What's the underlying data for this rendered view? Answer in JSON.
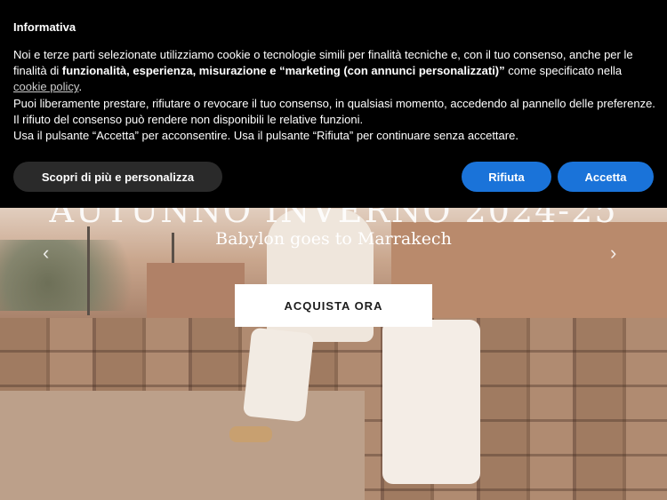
{
  "hero": {
    "title": "AUTUNNO INVERNO 2024-25",
    "subtitle": "Babylon goes to Marrakech",
    "cta_label": "ACQUISTA ORA",
    "prev_arrow": "‹",
    "next_arrow": "›"
  },
  "cookie_banner": {
    "title": "Informativa",
    "para1_start": "Noi e terze parti selezionate utilizziamo cookie o tecnologie simili per finalità tecniche e, con il tuo consenso, anche per le finalità di ",
    "para1_bold": "funzionalità, esperienza, misurazione e “marketing (con annunci personalizzati)”",
    "para1_mid": " come specificato nella ",
    "cookie_policy_link": "cookie policy",
    "para1_end": ".",
    "para2": "Puoi liberamente prestare, rifiutare o revocare il tuo consenso, in qualsiasi momento, accedendo al pannello delle preferenze. Il rifiuto del consenso può rendere non disponibili le relative funzioni.",
    "para3": "Usa il pulsante “Accetta” per acconsentire. Usa il pulsante “Rifiuta” per continuare senza accettare.",
    "customize_label": "Scopri di più e personalizza",
    "reject_label": "Rifiuta",
    "accept_label": "Accetta"
  }
}
